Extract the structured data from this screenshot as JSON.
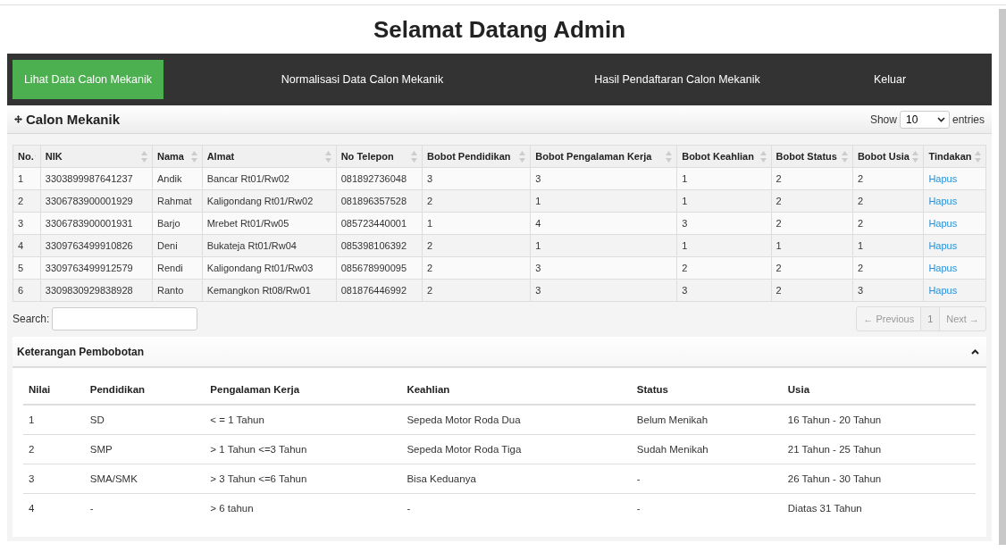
{
  "title": "Selamat Datang Admin",
  "nav": [
    {
      "label": "Lihat Data Calon Mekanik",
      "selected": true
    },
    {
      "label": "Normalisasi Data Calon Mekanik",
      "selected": false
    },
    {
      "label": "Hasil Pendaftaran Calon Mekanik",
      "selected": false
    },
    {
      "label": "Keluar",
      "selected": false
    }
  ],
  "panel": {
    "title": "Calon Mekanik",
    "show_label": "Show",
    "entries_value": "10",
    "entries_label": "entries"
  },
  "table": {
    "columns": [
      {
        "label": "No.",
        "sorted": true
      },
      {
        "label": "NIK",
        "sorted": false
      },
      {
        "label": "Nama",
        "sorted": false
      },
      {
        "label": "Almat",
        "sorted": false
      },
      {
        "label": "No Telepon",
        "sorted": false
      },
      {
        "label": "Bobot Pendidikan",
        "sorted": false
      },
      {
        "label": "Bobot Pengalaman Kerja",
        "sorted": false
      },
      {
        "label": "Bobot Keahlian",
        "sorted": false
      },
      {
        "label": "Bobot Status",
        "sorted": false
      },
      {
        "label": "Bobot Usia",
        "sorted": false
      },
      {
        "label": "Tindakan",
        "sorted": false
      }
    ],
    "rows": [
      [
        "1",
        "3303899987641237",
        "Andik",
        "Bancar Rt01/Rw02",
        "081892736048",
        "3",
        "3",
        "1",
        "2",
        "2",
        "Hapus"
      ],
      [
        "2",
        "3306783900001929",
        "Rahmat",
        "Kaligondang Rt01/Rw02",
        "081896357528",
        "2",
        "1",
        "1",
        "2",
        "2",
        "Hapus"
      ],
      [
        "3",
        "3306783900001931",
        "Barjo",
        "Mrebet Rt01/Rw05",
        "085723440001",
        "1",
        "4",
        "3",
        "2",
        "2",
        "Hapus"
      ],
      [
        "4",
        "3309763499910826",
        "Deni",
        "Bukateja Rt01/Rw04",
        "085398106392",
        "2",
        "1",
        "1",
        "1",
        "1",
        "Hapus"
      ],
      [
        "5",
        "3309763499912579",
        "Rendi",
        "Kaligondang Rt01/Rw03",
        "085678990095",
        "2",
        "3",
        "2",
        "2",
        "2",
        "Hapus"
      ],
      [
        "6",
        "3309830929838928",
        "Ranto",
        "Kemangkon Rt08/Rw01",
        "081876446992",
        "2",
        "3",
        "3",
        "2",
        "3",
        "Hapus"
      ]
    ]
  },
  "search": {
    "label": "Search:"
  },
  "pagination": [
    {
      "label": "← Previous",
      "kind": "nav",
      "disabled": true
    },
    {
      "label": "1",
      "kind": "page",
      "disabled": false
    },
    {
      "label": "Next →",
      "kind": "nav",
      "disabled": true
    }
  ],
  "legend": {
    "title": "Keterangan Pembobotan",
    "expanded": true,
    "columns": [
      "Nilai",
      "Pendidikan",
      "Pengalaman Kerja",
      "Keahlian",
      "Status",
      "Usia"
    ],
    "rows": [
      [
        "1",
        "SD",
        "< = 1 Tahun",
        "Sepeda Motor Roda Dua",
        "Belum Menikah",
        "16 Tahun - 20 Tahun"
      ],
      [
        "2",
        "SMP",
        "> 1 Tahun <=3 Tahun",
        "Sepeda Motor Roda Tiga",
        "Sudah Menikah",
        "21 Tahun - 25 Tahun"
      ],
      [
        "3",
        "SMA/SMK",
        "> 3 Tahun <=6 Tahun",
        "Bisa Keduanya",
        "-",
        "26 Tahun - 30 Tahun"
      ],
      [
        "4",
        "-",
        "> 6 tahun",
        "-",
        "-",
        "Diatas 31 Tahun"
      ]
    ]
  }
}
